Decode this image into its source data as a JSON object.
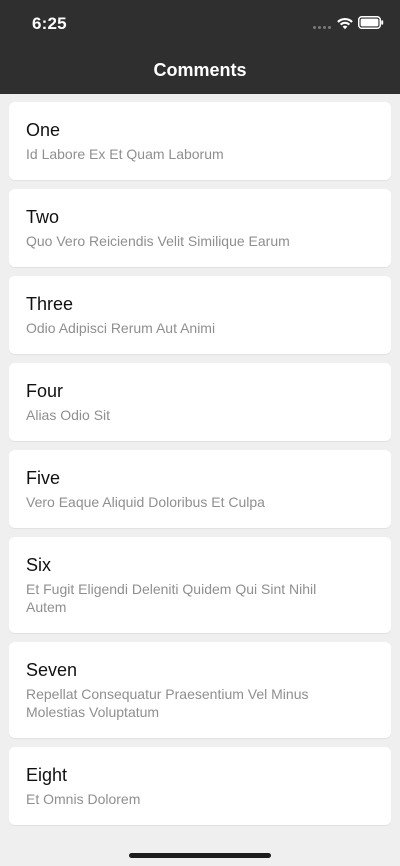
{
  "status_bar": {
    "time": "6:25"
  },
  "nav": {
    "title": "Comments"
  },
  "comments": [
    {
      "title": "One",
      "body": "Id Labore Ex Et Quam Laborum"
    },
    {
      "title": "Two",
      "body": "Quo Vero Reiciendis Velit Similique Earum"
    },
    {
      "title": "Three",
      "body": "Odio Adipisci Rerum Aut Animi"
    },
    {
      "title": "Four",
      "body": "Alias Odio Sit"
    },
    {
      "title": "Five",
      "body": "Vero Eaque Aliquid Doloribus Et Culpa"
    },
    {
      "title": "Six",
      "body": "Et Fugit Eligendi Deleniti Quidem Qui Sint Nihil Autem"
    },
    {
      "title": "Seven",
      "body": "Repellat Consequatur Praesentium Vel Minus Molestias Voluptatum"
    },
    {
      "title": "Eight",
      "body": "Et Omnis Dolorem"
    }
  ],
  "icons": {
    "signal": "cellular-signal-icon",
    "wifi": "wifi-icon",
    "battery": "battery-icon"
  },
  "colors": {
    "header_bg": "#2f2f2f",
    "page_bg": "#efefef",
    "card_bg": "#ffffff",
    "subtitle": "#8f8f8f"
  }
}
